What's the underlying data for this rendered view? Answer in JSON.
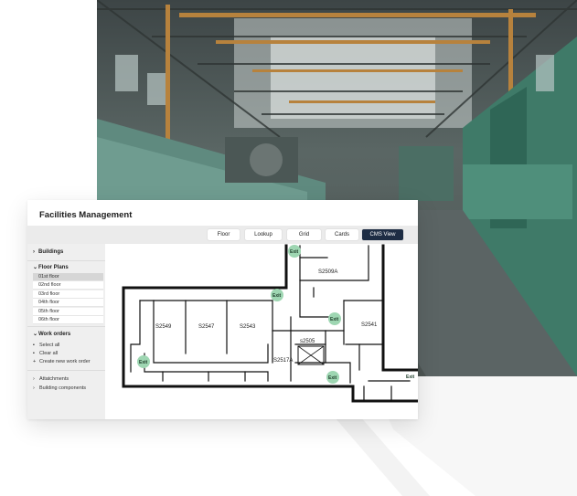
{
  "app": {
    "title": "Facilities Management",
    "tabs": [
      {
        "label": "Floor",
        "active": false
      },
      {
        "label": "Lookup",
        "active": false
      },
      {
        "label": "Grid",
        "active": false
      },
      {
        "label": "Cards",
        "active": false
      },
      {
        "label": "CMS View",
        "active": true
      }
    ]
  },
  "sidebar": {
    "buildings": "Buildings",
    "floor_plans": "Floor Plans",
    "floors": [
      "01st floor",
      "02nd floor",
      "03rd floor",
      "04th floor",
      "05th floor",
      "06th floor"
    ],
    "selected_floor": "01st floor",
    "work_orders": "Work orders",
    "work_order_items": [
      "Select all",
      "Clear all",
      "Create new work order"
    ],
    "attachments": "Attatchments",
    "building_components": "Building components"
  },
  "floorplan": {
    "rooms": [
      "S2549",
      "S2547",
      "S2543",
      "S2509A",
      "S2541",
      "s2505",
      "S2517A"
    ],
    "exit_label": "Exit"
  },
  "colors": {
    "accent": "#1e2d44",
    "exit_marker": "#9ed6b2"
  },
  "icons": {
    "expanded": "chevron-down-icon",
    "collapsed": "chevron-right-icon"
  }
}
